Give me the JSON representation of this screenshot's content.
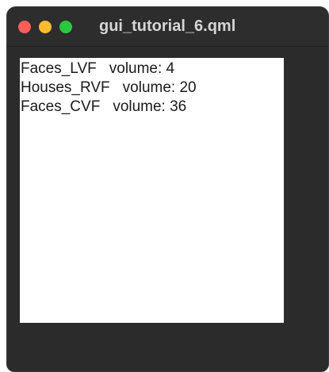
{
  "window": {
    "title": "gui_tutorial_6.qml",
    "colors": {
      "close": "#fe5f57",
      "minimize": "#febc2e",
      "zoom": "#28c840"
    }
  },
  "list": {
    "items": [
      {
        "name": "Faces_LVF",
        "volume_label": "volume: 4"
      },
      {
        "name": "Houses_RVF",
        "volume_label": "volume: 20"
      },
      {
        "name": "Faces_CVF",
        "volume_label": "volume: 36"
      }
    ]
  }
}
